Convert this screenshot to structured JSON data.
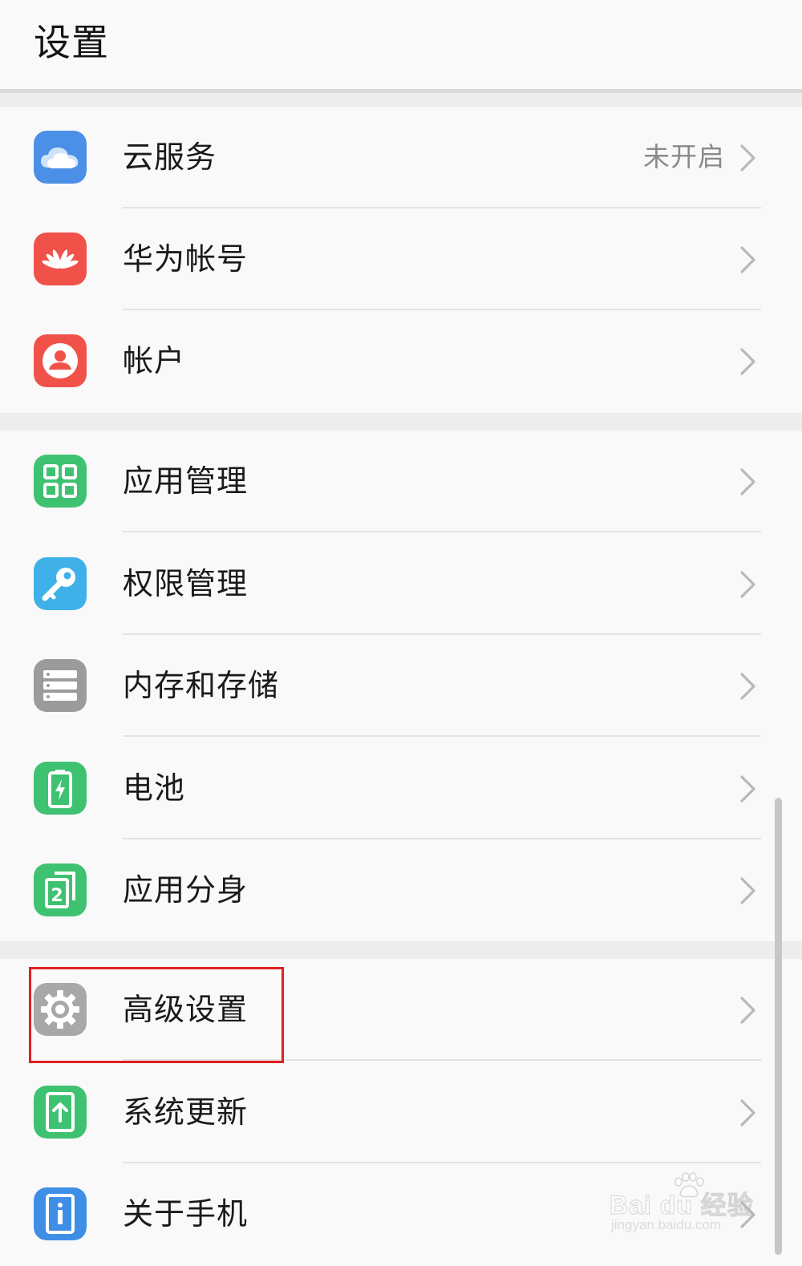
{
  "header": {
    "title": "设置"
  },
  "groups": [
    {
      "items": [
        {
          "label": "云服务",
          "value": "未开启",
          "icon": "cloud-icon"
        },
        {
          "label": "华为帐号",
          "value": "",
          "icon": "huawei-logo-icon"
        },
        {
          "label": "帐户",
          "value": "",
          "icon": "person-icon"
        }
      ]
    },
    {
      "items": [
        {
          "label": "应用管理",
          "value": "",
          "icon": "app-grid-icon"
        },
        {
          "label": "权限管理",
          "value": "",
          "icon": "key-icon"
        },
        {
          "label": "内存和存储",
          "value": "",
          "icon": "storage-icon"
        },
        {
          "label": "电池",
          "value": "",
          "icon": "battery-icon"
        },
        {
          "label": "应用分身",
          "value": "",
          "icon": "app-twin-icon"
        }
      ]
    },
    {
      "items": [
        {
          "label": "高级设置",
          "value": "",
          "icon": "gear-icon"
        },
        {
          "label": "系统更新",
          "value": "",
          "icon": "system-update-icon"
        },
        {
          "label": "关于手机",
          "value": "",
          "icon": "phone-info-icon"
        }
      ]
    }
  ],
  "colors": {
    "cloud": "#4b8fe6",
    "huawei": "#f0524a",
    "account": "#f0524a",
    "green": "#3ec271",
    "key": "#3fb0e8",
    "storage": "#9b9b9b",
    "gear": "#a8a8a8",
    "about": "#3f8ee6",
    "highlight_border": "#e02020"
  },
  "watermark": {
    "main": "Bai du 经验",
    "sub": "jingyan.baidu.com"
  }
}
